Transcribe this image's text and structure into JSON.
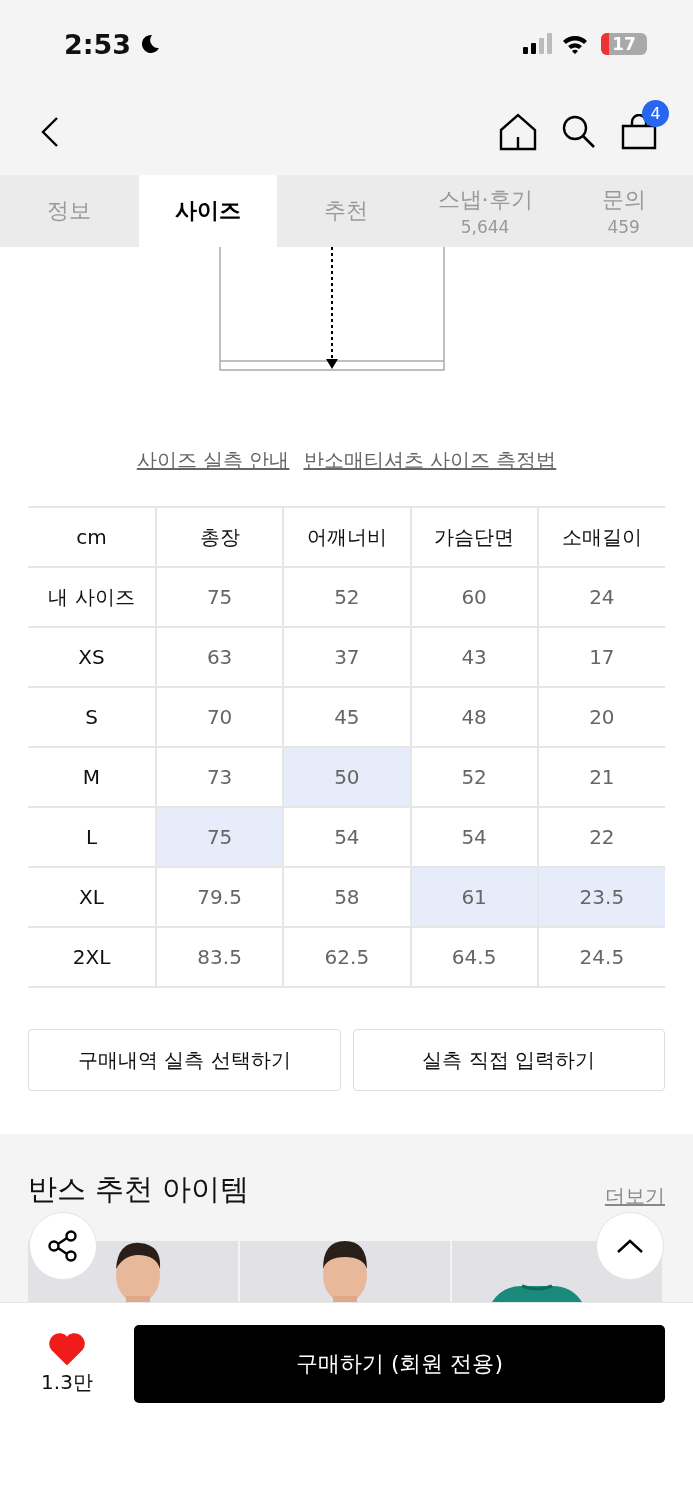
{
  "status_bar": {
    "time": "2:53",
    "battery": "17"
  },
  "header": {
    "cart_count": "4"
  },
  "tabs": [
    {
      "label": "정보",
      "selected": false
    },
    {
      "label": "사이즈",
      "selected": true
    },
    {
      "label": "추천",
      "selected": false
    },
    {
      "label": "스냅·후기",
      "count": "5,644",
      "selected": false
    },
    {
      "label": "문의",
      "count": "459",
      "selected": false
    }
  ],
  "links": [
    "사이즈 실측 안내",
    "반소매티셔츠 사이즈 측정법"
  ],
  "size_table": {
    "unit": "cm",
    "columns": [
      "총장",
      "어깨너비",
      "가슴단면",
      "소매길이"
    ],
    "rows": [
      {
        "size": "내 사이즈",
        "cells": [
          {
            "value": "75",
            "highlighted": false
          },
          {
            "value": "52",
            "highlighted": false
          },
          {
            "value": "60",
            "highlighted": false
          },
          {
            "value": "24",
            "highlighted": false
          }
        ]
      },
      {
        "size": "XS",
        "cells": [
          {
            "value": "63",
            "highlighted": false
          },
          {
            "value": "37",
            "highlighted": false
          },
          {
            "value": "43",
            "highlighted": false
          },
          {
            "value": "17",
            "highlighted": false
          }
        ]
      },
      {
        "size": "S",
        "cells": [
          {
            "value": "70",
            "highlighted": false
          },
          {
            "value": "45",
            "highlighted": false
          },
          {
            "value": "48",
            "highlighted": false
          },
          {
            "value": "20",
            "highlighted": false
          }
        ]
      },
      {
        "size": "M",
        "cells": [
          {
            "value": "73",
            "highlighted": false
          },
          {
            "value": "50",
            "highlighted": true
          },
          {
            "value": "52",
            "highlighted": false
          },
          {
            "value": "21",
            "highlighted": false
          }
        ]
      },
      {
        "size": "L",
        "cells": [
          {
            "value": "75",
            "highlighted": true
          },
          {
            "value": "54",
            "highlighted": false
          },
          {
            "value": "54",
            "highlighted": false
          },
          {
            "value": "22",
            "highlighted": false
          }
        ]
      },
      {
        "size": "XL",
        "cells": [
          {
            "value": "79.5",
            "highlighted": false
          },
          {
            "value": "58",
            "highlighted": false
          },
          {
            "value": "61",
            "highlighted": true
          },
          {
            "value": "23.5",
            "highlighted": true
          }
        ]
      },
      {
        "size": "2XL",
        "cells": [
          {
            "value": "83.5",
            "highlighted": false
          },
          {
            "value": "62.5",
            "highlighted": false
          },
          {
            "value": "64.5",
            "highlighted": false
          },
          {
            "value": "24.5",
            "highlighted": false
          }
        ]
      }
    ]
  },
  "action_buttons": [
    "구매내역 실측 선택하기",
    "실측 직접 입력하기"
  ],
  "recommended": {
    "title": "반스 추천 아이템",
    "more_link": "더보기"
  },
  "bottom_bar": {
    "likes": "1.3만",
    "liked": true,
    "buy_button": "구매하기 (회원 전용)"
  }
}
